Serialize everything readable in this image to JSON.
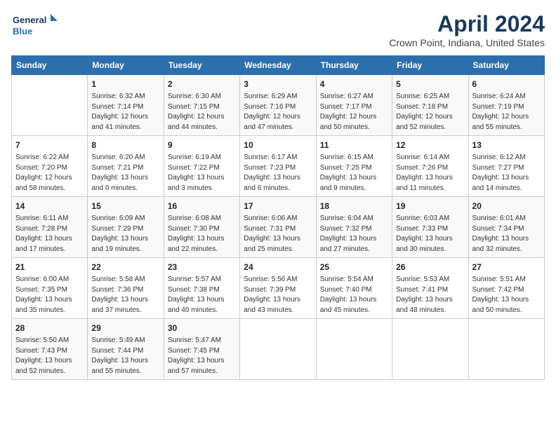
{
  "header": {
    "logo_line1": "General",
    "logo_line2": "Blue",
    "month": "April 2024",
    "location": "Crown Point, Indiana, United States"
  },
  "days_of_week": [
    "Sunday",
    "Monday",
    "Tuesday",
    "Wednesday",
    "Thursday",
    "Friday",
    "Saturday"
  ],
  "weeks": [
    [
      {
        "num": "",
        "sunrise": "",
        "sunset": "",
        "daylight": ""
      },
      {
        "num": "1",
        "sunrise": "Sunrise: 6:32 AM",
        "sunset": "Sunset: 7:14 PM",
        "daylight": "Daylight: 12 hours and 41 minutes."
      },
      {
        "num": "2",
        "sunrise": "Sunrise: 6:30 AM",
        "sunset": "Sunset: 7:15 PM",
        "daylight": "Daylight: 12 hours and 44 minutes."
      },
      {
        "num": "3",
        "sunrise": "Sunrise: 6:29 AM",
        "sunset": "Sunset: 7:16 PM",
        "daylight": "Daylight: 12 hours and 47 minutes."
      },
      {
        "num": "4",
        "sunrise": "Sunrise: 6:27 AM",
        "sunset": "Sunset: 7:17 PM",
        "daylight": "Daylight: 12 hours and 50 minutes."
      },
      {
        "num": "5",
        "sunrise": "Sunrise: 6:25 AM",
        "sunset": "Sunset: 7:18 PM",
        "daylight": "Daylight: 12 hours and 52 minutes."
      },
      {
        "num": "6",
        "sunrise": "Sunrise: 6:24 AM",
        "sunset": "Sunset: 7:19 PM",
        "daylight": "Daylight: 12 hours and 55 minutes."
      }
    ],
    [
      {
        "num": "7",
        "sunrise": "Sunrise: 6:22 AM",
        "sunset": "Sunset: 7:20 PM",
        "daylight": "Daylight: 12 hours and 58 minutes."
      },
      {
        "num": "8",
        "sunrise": "Sunrise: 6:20 AM",
        "sunset": "Sunset: 7:21 PM",
        "daylight": "Daylight: 13 hours and 0 minutes."
      },
      {
        "num": "9",
        "sunrise": "Sunrise: 6:19 AM",
        "sunset": "Sunset: 7:22 PM",
        "daylight": "Daylight: 13 hours and 3 minutes."
      },
      {
        "num": "10",
        "sunrise": "Sunrise: 6:17 AM",
        "sunset": "Sunset: 7:23 PM",
        "daylight": "Daylight: 13 hours and 6 minutes."
      },
      {
        "num": "11",
        "sunrise": "Sunrise: 6:15 AM",
        "sunset": "Sunset: 7:25 PM",
        "daylight": "Daylight: 13 hours and 9 minutes."
      },
      {
        "num": "12",
        "sunrise": "Sunrise: 6:14 AM",
        "sunset": "Sunset: 7:26 PM",
        "daylight": "Daylight: 13 hours and 11 minutes."
      },
      {
        "num": "13",
        "sunrise": "Sunrise: 6:12 AM",
        "sunset": "Sunset: 7:27 PM",
        "daylight": "Daylight: 13 hours and 14 minutes."
      }
    ],
    [
      {
        "num": "14",
        "sunrise": "Sunrise: 6:11 AM",
        "sunset": "Sunset: 7:28 PM",
        "daylight": "Daylight: 13 hours and 17 minutes."
      },
      {
        "num": "15",
        "sunrise": "Sunrise: 6:09 AM",
        "sunset": "Sunset: 7:29 PM",
        "daylight": "Daylight: 13 hours and 19 minutes."
      },
      {
        "num": "16",
        "sunrise": "Sunrise: 6:08 AM",
        "sunset": "Sunset: 7:30 PM",
        "daylight": "Daylight: 13 hours and 22 minutes."
      },
      {
        "num": "17",
        "sunrise": "Sunrise: 6:06 AM",
        "sunset": "Sunset: 7:31 PM",
        "daylight": "Daylight: 13 hours and 25 minutes."
      },
      {
        "num": "18",
        "sunrise": "Sunrise: 6:04 AM",
        "sunset": "Sunset: 7:32 PM",
        "daylight": "Daylight: 13 hours and 27 minutes."
      },
      {
        "num": "19",
        "sunrise": "Sunrise: 6:03 AM",
        "sunset": "Sunset: 7:33 PM",
        "daylight": "Daylight: 13 hours and 30 minutes."
      },
      {
        "num": "20",
        "sunrise": "Sunrise: 6:01 AM",
        "sunset": "Sunset: 7:34 PM",
        "daylight": "Daylight: 13 hours and 32 minutes."
      }
    ],
    [
      {
        "num": "21",
        "sunrise": "Sunrise: 6:00 AM",
        "sunset": "Sunset: 7:35 PM",
        "daylight": "Daylight: 13 hours and 35 minutes."
      },
      {
        "num": "22",
        "sunrise": "Sunrise: 5:58 AM",
        "sunset": "Sunset: 7:36 PM",
        "daylight": "Daylight: 13 hours and 37 minutes."
      },
      {
        "num": "23",
        "sunrise": "Sunrise: 5:57 AM",
        "sunset": "Sunset: 7:38 PM",
        "daylight": "Daylight: 13 hours and 40 minutes."
      },
      {
        "num": "24",
        "sunrise": "Sunrise: 5:56 AM",
        "sunset": "Sunset: 7:39 PM",
        "daylight": "Daylight: 13 hours and 43 minutes."
      },
      {
        "num": "25",
        "sunrise": "Sunrise: 5:54 AM",
        "sunset": "Sunset: 7:40 PM",
        "daylight": "Daylight: 13 hours and 45 minutes."
      },
      {
        "num": "26",
        "sunrise": "Sunrise: 5:53 AM",
        "sunset": "Sunset: 7:41 PM",
        "daylight": "Daylight: 13 hours and 48 minutes."
      },
      {
        "num": "27",
        "sunrise": "Sunrise: 5:51 AM",
        "sunset": "Sunset: 7:42 PM",
        "daylight": "Daylight: 13 hours and 50 minutes."
      }
    ],
    [
      {
        "num": "28",
        "sunrise": "Sunrise: 5:50 AM",
        "sunset": "Sunset: 7:43 PM",
        "daylight": "Daylight: 13 hours and 52 minutes."
      },
      {
        "num": "29",
        "sunrise": "Sunrise: 5:49 AM",
        "sunset": "Sunset: 7:44 PM",
        "daylight": "Daylight: 13 hours and 55 minutes."
      },
      {
        "num": "30",
        "sunrise": "Sunrise: 5:47 AM",
        "sunset": "Sunset: 7:45 PM",
        "daylight": "Daylight: 13 hours and 57 minutes."
      },
      {
        "num": "",
        "sunrise": "",
        "sunset": "",
        "daylight": ""
      },
      {
        "num": "",
        "sunrise": "",
        "sunset": "",
        "daylight": ""
      },
      {
        "num": "",
        "sunrise": "",
        "sunset": "",
        "daylight": ""
      },
      {
        "num": "",
        "sunrise": "",
        "sunset": "",
        "daylight": ""
      }
    ]
  ]
}
